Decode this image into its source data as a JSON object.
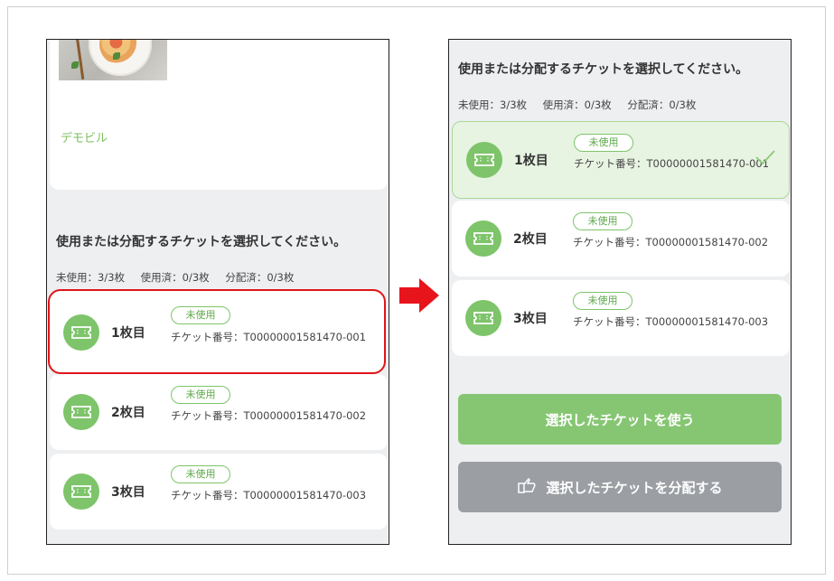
{
  "left_screen": {
    "shop_name": "デモビル",
    "section_title": "使用または分配するチケットを選択してください。",
    "counts": {
      "unused": "未使用：3/3枚",
      "used": "使用済：0/3枚",
      "distributed": "分配済：0/3枚"
    },
    "tickets": [
      {
        "label": "1枚目",
        "status": "未使用",
        "number": "チケット番号：T00000001581470-001"
      },
      {
        "label": "2枚目",
        "status": "未使用",
        "number": "チケット番号：T00000001581470-002"
      },
      {
        "label": "3枚目",
        "status": "未使用",
        "number": "チケット番号：T00000001581470-003"
      }
    ]
  },
  "right_screen": {
    "section_title": "使用または分配するチケットを選択してください。",
    "counts": {
      "unused": "未使用：3/3枚",
      "used": "使用済：0/3枚",
      "distributed": "分配済：0/3枚"
    },
    "tickets": [
      {
        "label": "1枚目",
        "status": "未使用",
        "number": "チケット番号：T00000001581470-001",
        "selected": true
      },
      {
        "label": "2枚目",
        "status": "未使用",
        "number": "チケット番号：T00000001581470-002",
        "selected": false
      },
      {
        "label": "3枚目",
        "status": "未使用",
        "number": "チケット番号：T00000001581470-003",
        "selected": false
      }
    ],
    "use_button": "選択したチケットを使う",
    "distribute_button": "選択したチケットを分配する"
  },
  "colors": {
    "accent_green": "#7ec46a",
    "highlight_red": "#e0151a",
    "gray_button": "#9b9ea3"
  },
  "icons": [
    "ticket-icon",
    "checkmark-icon",
    "share-icon",
    "arrow-right-icon"
  ]
}
